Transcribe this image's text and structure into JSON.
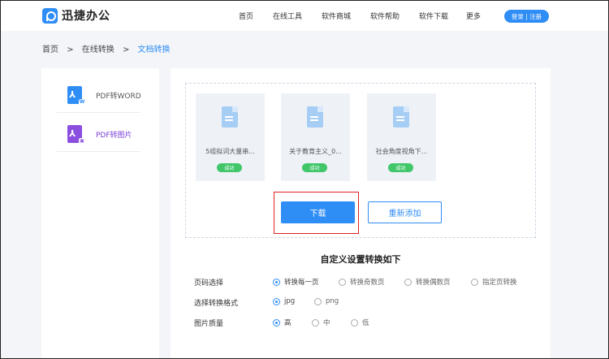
{
  "header": {
    "logo_text": "迅捷办公",
    "nav": [
      "首页",
      "在线工具",
      "软件商城",
      "软件帮助",
      "软件下载",
      "更多"
    ],
    "login_label": "登录 | 注册"
  },
  "breadcrumb": {
    "home": "首页",
    "sep1": ">",
    "online": "在线转换",
    "sep2": ">",
    "current": "文档转换"
  },
  "sidebar": {
    "items": [
      {
        "label": "PDF转WORD",
        "icon": "pdf-to-word-icon",
        "color": "#2f8df6",
        "badge": "W"
      },
      {
        "label": "PDF转图片",
        "icon": "pdf-to-image-icon",
        "color": "#8b4fe0",
        "badge": "▣"
      }
    ]
  },
  "files": [
    {
      "name": "5组拟词大量串...",
      "status": "成功"
    },
    {
      "name": "关于教育主义_0...",
      "status": "成功"
    },
    {
      "name": "社会角度视角下...",
      "status": "成功"
    }
  ],
  "actions": {
    "download": "下载",
    "readd": "重新添加"
  },
  "settings": {
    "title": "自定义设置转换如下",
    "page": {
      "label": "页码选择",
      "options": [
        "转换每一页",
        "转换奇数页",
        "转换偶数页",
        "指定页转换"
      ],
      "selected": 0
    },
    "format": {
      "label": "选择转换格式",
      "options": [
        "jpg",
        "png"
      ],
      "selected": 0
    },
    "quality": {
      "label": "图片质量",
      "options": [
        "高",
        "中",
        "低"
      ],
      "selected": 0
    }
  },
  "colors": {
    "accent": "#2f8df6",
    "success": "#41c66a",
    "highlight": "#e02020",
    "purple": "#8b4fe0"
  }
}
